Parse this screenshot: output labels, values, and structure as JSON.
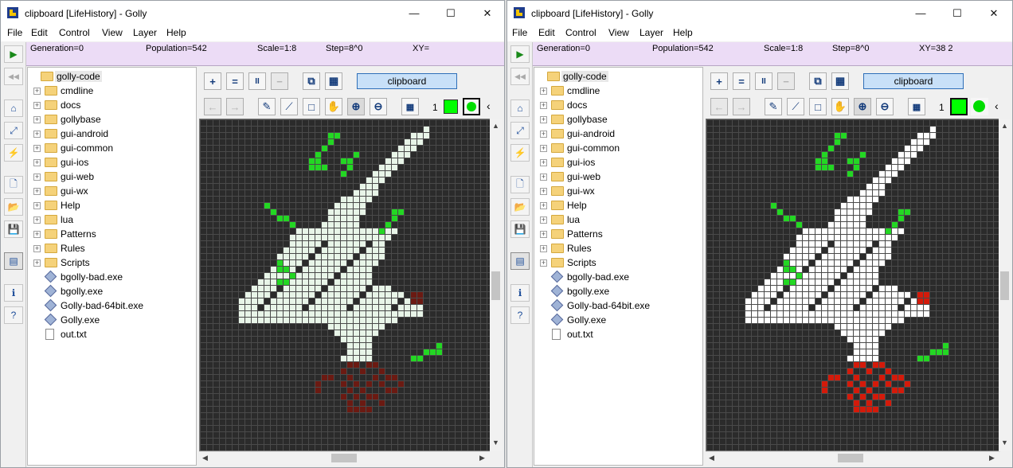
{
  "windows": [
    {
      "title": "clipboard [LifeHistory] - Golly",
      "menu": [
        "File",
        "Edit",
        "Control",
        "View",
        "Layer",
        "Help"
      ],
      "status": {
        "generation": "Generation=0",
        "population": "Population=542",
        "scale": "Scale=1:8",
        "step": "Step=8^0",
        "xy": "XY="
      },
      "layer_name": "clipboard",
      "layer_count": "1",
      "tree": {
        "root": "golly-code",
        "folders": [
          "cmdline",
          "docs",
          "gollybase",
          "gui-android",
          "gui-common",
          "gui-ios",
          "gui-web",
          "gui-wx",
          "Help",
          "lua",
          "Patterns",
          "Rules",
          "Scripts"
        ],
        "files": [
          "bgolly-bad.exe",
          "bgolly.exe",
          "Golly-bad-64bit.exe",
          "Golly.exe"
        ],
        "text_files": [
          "out.txt"
        ]
      },
      "theme": {
        "live": "#e8f5e8",
        "dead_outline": "#1a1a5a",
        "marked": "#23d723",
        "state3": "#6b1a12",
        "grid": "#4a4a4a",
        "bg": "#2b2b2b"
      }
    },
    {
      "title": "clipboard [LifeHistory] - Golly",
      "menu": [
        "File",
        "Edit",
        "Control",
        "View",
        "Layer",
        "Help"
      ],
      "status": {
        "generation": "Generation=0",
        "population": "Population=542",
        "scale": "Scale=1:8",
        "step": "Step=8^0",
        "xy": "XY=38 2"
      },
      "layer_name": "clipboard",
      "layer_count": "1",
      "tree": {
        "root": "golly-code",
        "folders": [
          "cmdline",
          "docs",
          "gollybase",
          "gui-android",
          "gui-common",
          "gui-ios",
          "gui-web",
          "gui-wx",
          "Help",
          "lua",
          "Patterns",
          "Rules",
          "Scripts"
        ],
        "files": [
          "bgolly-bad.exe",
          "bgolly.exe",
          "Golly-bad-64bit.exe",
          "Golly.exe"
        ],
        "text_files": [
          "out.txt"
        ]
      },
      "theme": {
        "live": "#ffffff",
        "dead_outline": "#0b0b8a",
        "marked": "#23d723",
        "state3": "#d41a0a",
        "grid": "#4a4a4a",
        "bg": "#2b2b2b"
      }
    }
  ],
  "icons": {
    "play": "▶",
    "rewind": "◀◀",
    "plus": "+",
    "equals": "=",
    "pause": "II",
    "minus": "−",
    "back": "←",
    "forward": "→",
    "pencil": "✎",
    "pick": "⟋",
    "select": "□",
    "hand": "✋",
    "zoom_in": "⊕",
    "zoom_out": "⊖",
    "grid": "▦",
    "chevron": "‹"
  }
}
